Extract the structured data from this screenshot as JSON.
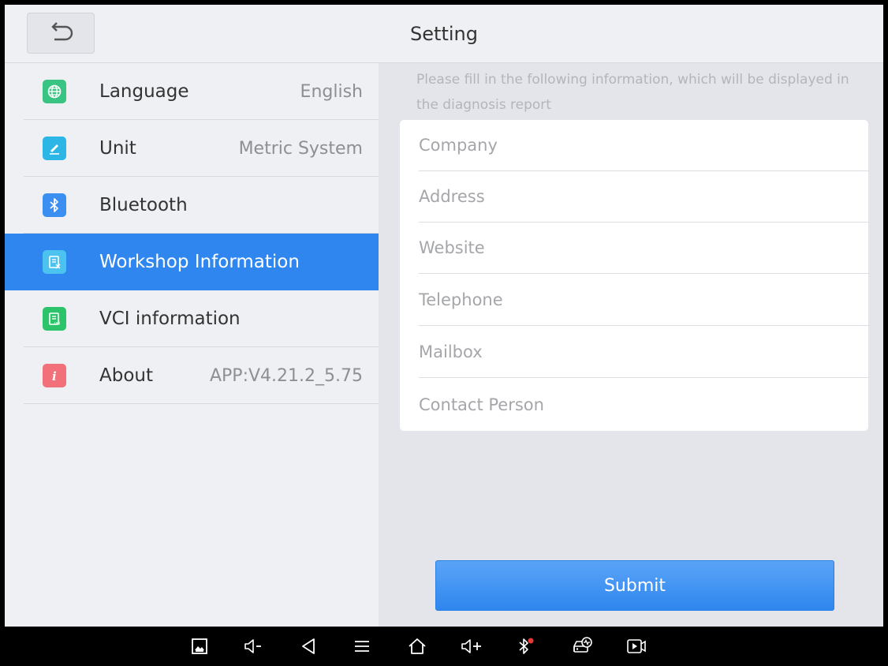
{
  "header": {
    "title": "Setting",
    "back_icon": "back-arrow-icon"
  },
  "sidebar": {
    "items": [
      {
        "label": "Language",
        "value": "English",
        "icon": "globe-icon",
        "icon_color": "#3ac483"
      },
      {
        "label": "Unit",
        "value": "Metric System",
        "icon": "ruler-icon",
        "icon_color": "#2bb6e6"
      },
      {
        "label": "Bluetooth",
        "value": "",
        "icon": "bluetooth-icon",
        "icon_color": "#3a8ff0"
      },
      {
        "label": "Workshop Information",
        "value": "",
        "icon": "workshop-icon",
        "icon_color": "#4cc3ee",
        "active": true
      },
      {
        "label": "VCI information",
        "value": "",
        "icon": "vci-icon",
        "icon_color": "#2cc46a"
      },
      {
        "label": "About",
        "value": "APP:V4.21.2_5.75",
        "icon": "info-icon",
        "icon_color": "#f2707a"
      }
    ]
  },
  "main": {
    "hint": "Please fill in the following information, which will be displayed in the diagnosis report",
    "fields": [
      {
        "placeholder": "Company",
        "value": ""
      },
      {
        "placeholder": "Address",
        "value": ""
      },
      {
        "placeholder": "Website",
        "value": ""
      },
      {
        "placeholder": "Telephone",
        "value": ""
      },
      {
        "placeholder": "Mailbox",
        "value": ""
      },
      {
        "placeholder": "Contact Person",
        "value": ""
      }
    ],
    "submit_label": "Submit"
  },
  "navbar": {
    "icons": [
      "screenshot-icon",
      "volume-down-icon",
      "back-icon",
      "menu-icon",
      "home-icon",
      "volume-up-icon",
      "bluetooth-status-icon",
      "car-diagnostic-icon",
      "screen-record-icon"
    ]
  },
  "colors": {
    "accent": "#2f86ee",
    "sidebar_bg": "#eef0f3",
    "main_bg": "#e3e5ea"
  }
}
